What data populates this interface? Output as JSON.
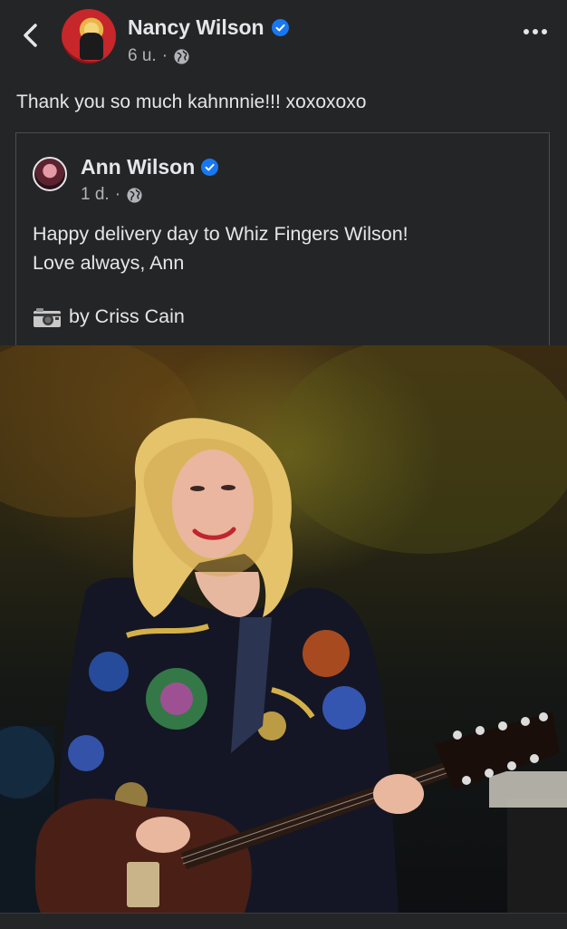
{
  "post": {
    "author": "Nancy Wilson",
    "time": "6 u.",
    "separator": "·",
    "text": "Thank you so much kahnnnie!!! xoxoxoxo"
  },
  "shared_post": {
    "author": "Ann Wilson",
    "time": "1 d.",
    "separator": "·",
    "line1": "Happy delivery day to Whiz Fingers Wilson!",
    "line2": "Love always, Ann",
    "credit": "by Criss Cain"
  },
  "icons": {
    "back": "chevron-left-icon",
    "verified": "verified-badge-icon",
    "audience": "globe-icon",
    "more": "more-options-icon",
    "credit": "camera-icon"
  },
  "colors": {
    "background": "#242526",
    "text": "#e4e6eb",
    "secondary_text": "#b0b3b8",
    "verified_blue": "#1877f2"
  }
}
